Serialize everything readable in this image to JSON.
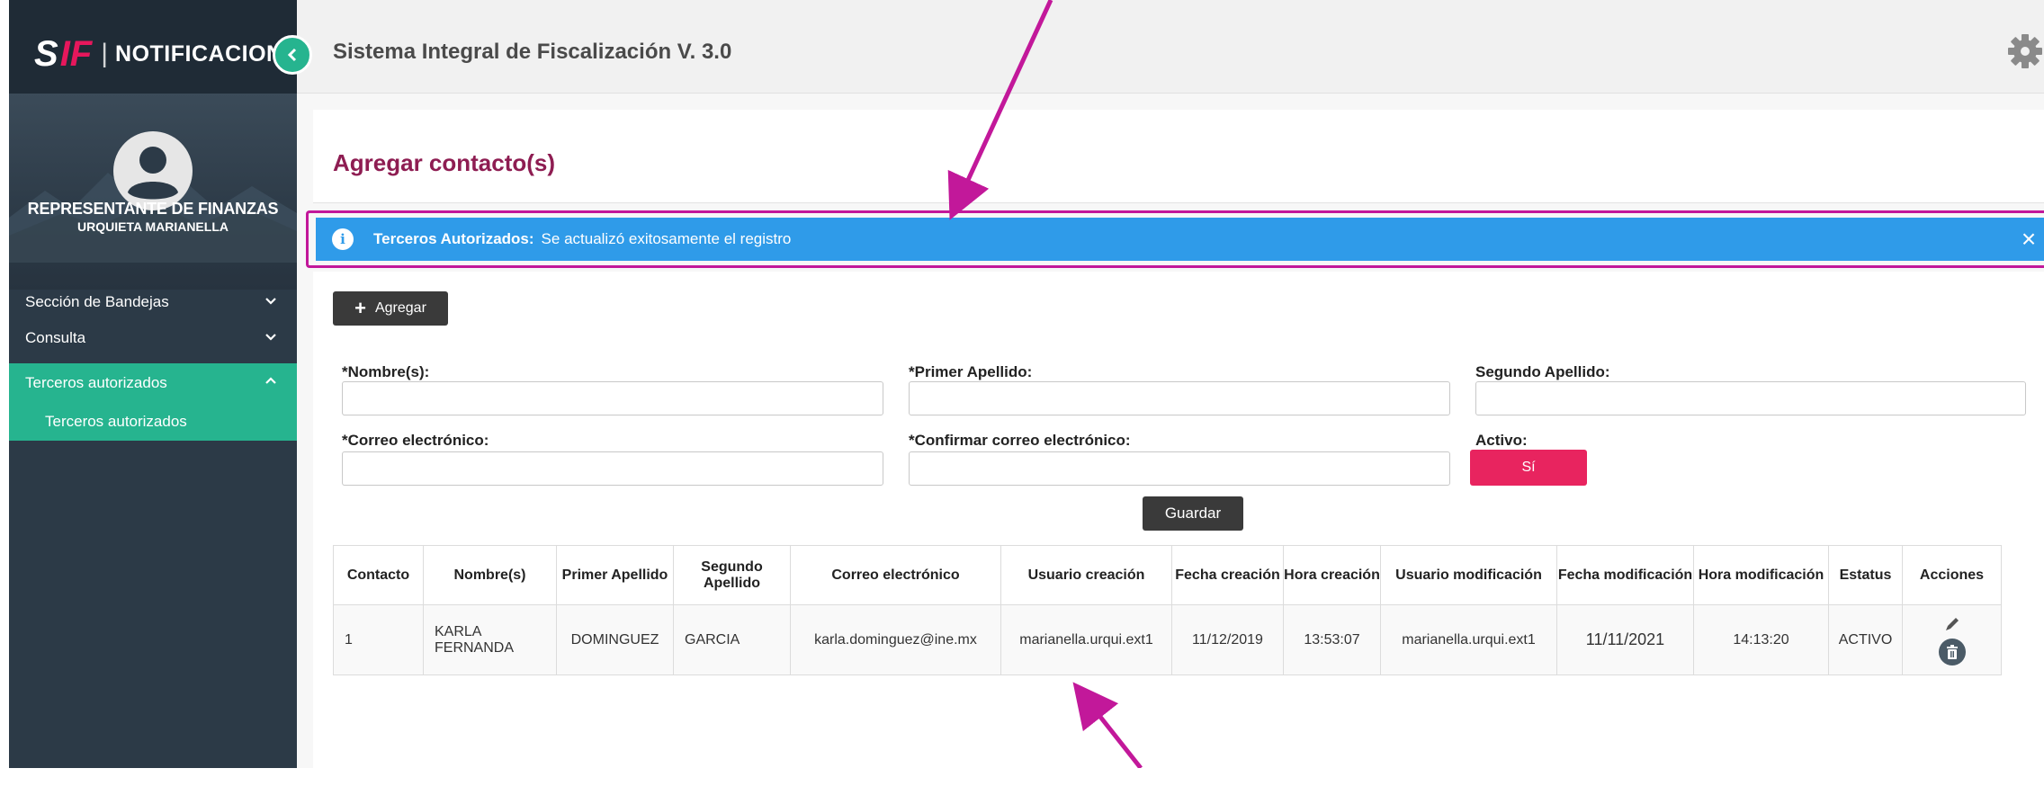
{
  "sidebar": {
    "logo_s": "S",
    "logo_if": "IF",
    "logo_sep": "|",
    "logo_text": "NOTIFICACIONES",
    "role": "REPRESENTANTE DE FINANZAS",
    "user": "URQUIETA MARIANELLA",
    "nav": [
      {
        "label": "Sección de Bandejas",
        "expanded": false
      },
      {
        "label": "Consulta",
        "expanded": false
      },
      {
        "label": "Terceros autorizados",
        "expanded": true
      }
    ],
    "sub_item": "Terceros autorizados",
    "accent_color": "#26b48f"
  },
  "topbar": {
    "title": "Sistema Integral de Fiscalización V. 3.0"
  },
  "page": {
    "title": "Agregar contacto(s)"
  },
  "alert": {
    "title": "Terceros Autorizados:",
    "message": "Se actualizó exitosamente el registro",
    "color": "#2f9be9"
  },
  "form": {
    "add_label": "Agregar",
    "fields": {
      "nombre": {
        "label": "*Nombre(s):",
        "value": ""
      },
      "primer_apellido": {
        "label": "*Primer Apellido:",
        "value": ""
      },
      "segundo_apellido": {
        "label": "Segundo Apellido:",
        "value": ""
      },
      "correo": {
        "label": "*Correo electrónico:",
        "value": ""
      },
      "confirmar_correo": {
        "label": "*Confirmar correo electrónico:",
        "value": ""
      },
      "activo": {
        "label": "Activo:",
        "value": "Sí"
      }
    },
    "save_label": "Guardar"
  },
  "table": {
    "headers": [
      "Contacto",
      "Nombre(s)",
      "Primer Apellido",
      "Segundo Apellido",
      "Correo electrónico",
      "Usuario creación",
      "Fecha creación",
      "Hora creación",
      "Usuario modificación",
      "Fecha modificación",
      "Hora modificación",
      "Estatus",
      "Acciones"
    ],
    "rows": [
      [
        "1",
        "KARLA FERNANDA",
        "DOMINGUEZ",
        "GARCIA",
        "karla.dominguez@ine.mx",
        "marianella.urqui.ext1",
        "11/12/2019",
        "13:53:07",
        "marianella.urqui.ext1",
        "11/11/2021",
        "14:13:20",
        "ACTIVO"
      ]
    ]
  },
  "annotation_color": "#c2189a"
}
